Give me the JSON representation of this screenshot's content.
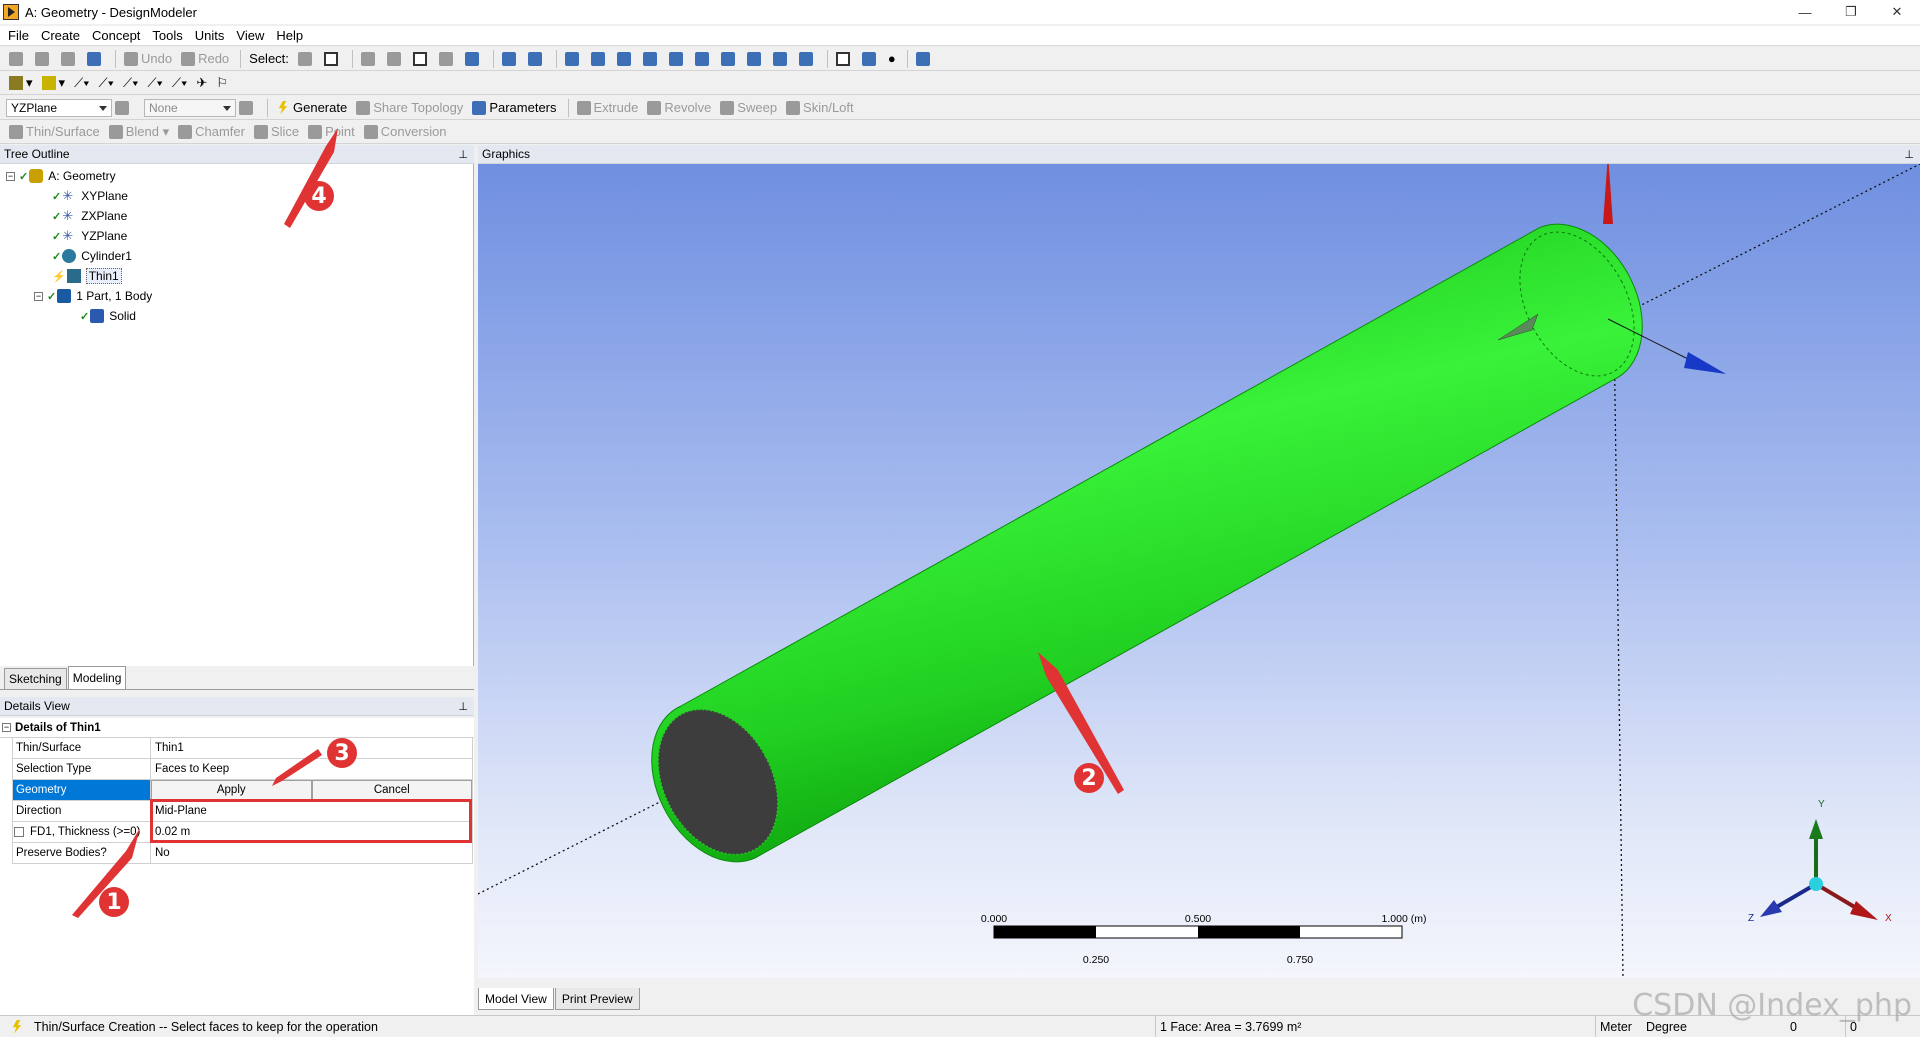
{
  "window": {
    "title": "A: Geometry - DesignModeler",
    "minimize": "—",
    "restore": "❐",
    "close": "✕"
  },
  "menu": [
    "File",
    "Create",
    "Concept",
    "Tools",
    "Units",
    "View",
    "Help"
  ],
  "toolbar1": {
    "undo": "Undo",
    "redo": "Redo",
    "select": "Select:"
  },
  "toolbar3": {
    "plane": "YZPlane",
    "sketch": "None",
    "generate": "Generate",
    "share_topology": "Share Topology",
    "parameters": "Parameters",
    "extrude": "Extrude",
    "revolve": "Revolve",
    "sweep": "Sweep",
    "skin_loft": "Skin/Loft"
  },
  "toolbar4": {
    "thin_surface": "Thin/Surface",
    "blend": "Blend",
    "chamfer": "Chamfer",
    "slice": "Slice",
    "point": "Point",
    "conversion": "Conversion"
  },
  "tree_outline": {
    "header": "Tree Outline",
    "nodes": [
      "A: Geometry",
      "XYPlane",
      "ZXPlane",
      "YZPlane",
      "Cylinder1",
      "Thin1",
      "1 Part, 1 Body",
      "Solid"
    ]
  },
  "tabs": {
    "sketching": "Sketching",
    "modeling": "Modeling"
  },
  "details": {
    "header": "Details View",
    "title": "Details of Thin1",
    "rows": {
      "thin_surface": {
        "k": "Thin/Surface",
        "v": "Thin1"
      },
      "selection_type": {
        "k": "Selection Type",
        "v": "Faces to Keep"
      },
      "geometry": {
        "k": "Geometry",
        "apply": "Apply",
        "cancel": "Cancel"
      },
      "direction": {
        "k": "Direction",
        "v": "Mid-Plane"
      },
      "thickness": {
        "k": "FD1, Thickness (>=0)",
        "v": "0.02 m"
      },
      "preserve": {
        "k": "Preserve Bodies?",
        "v": "No"
      }
    }
  },
  "graphics": {
    "header": "Graphics",
    "scale": {
      "t0": "0.000",
      "t1": "0.250",
      "t2": "0.500",
      "t3": "0.750",
      "t4": "1.000 (m)"
    },
    "axes": {
      "x": "X",
      "y": "Y",
      "z": "Z"
    },
    "tabs": {
      "model_view": "Model View",
      "print_preview": "Print Preview"
    }
  },
  "annotations": {
    "b1": "1",
    "b2": "2",
    "b3": "3",
    "b4": "4"
  },
  "status": {
    "message": "Thin/Surface Creation -- Select faces to keep for the operation",
    "selection": "1 Face: Area = 3.7699 m²",
    "units_length": "Meter",
    "units_angle": "Degree",
    "c1": "0",
    "c2": "0"
  },
  "watermark": "CSDN @Index_php",
  "colors": {
    "cylinder": "#22e022",
    "annotation": "#e03333",
    "highlight": "#0078d7"
  }
}
